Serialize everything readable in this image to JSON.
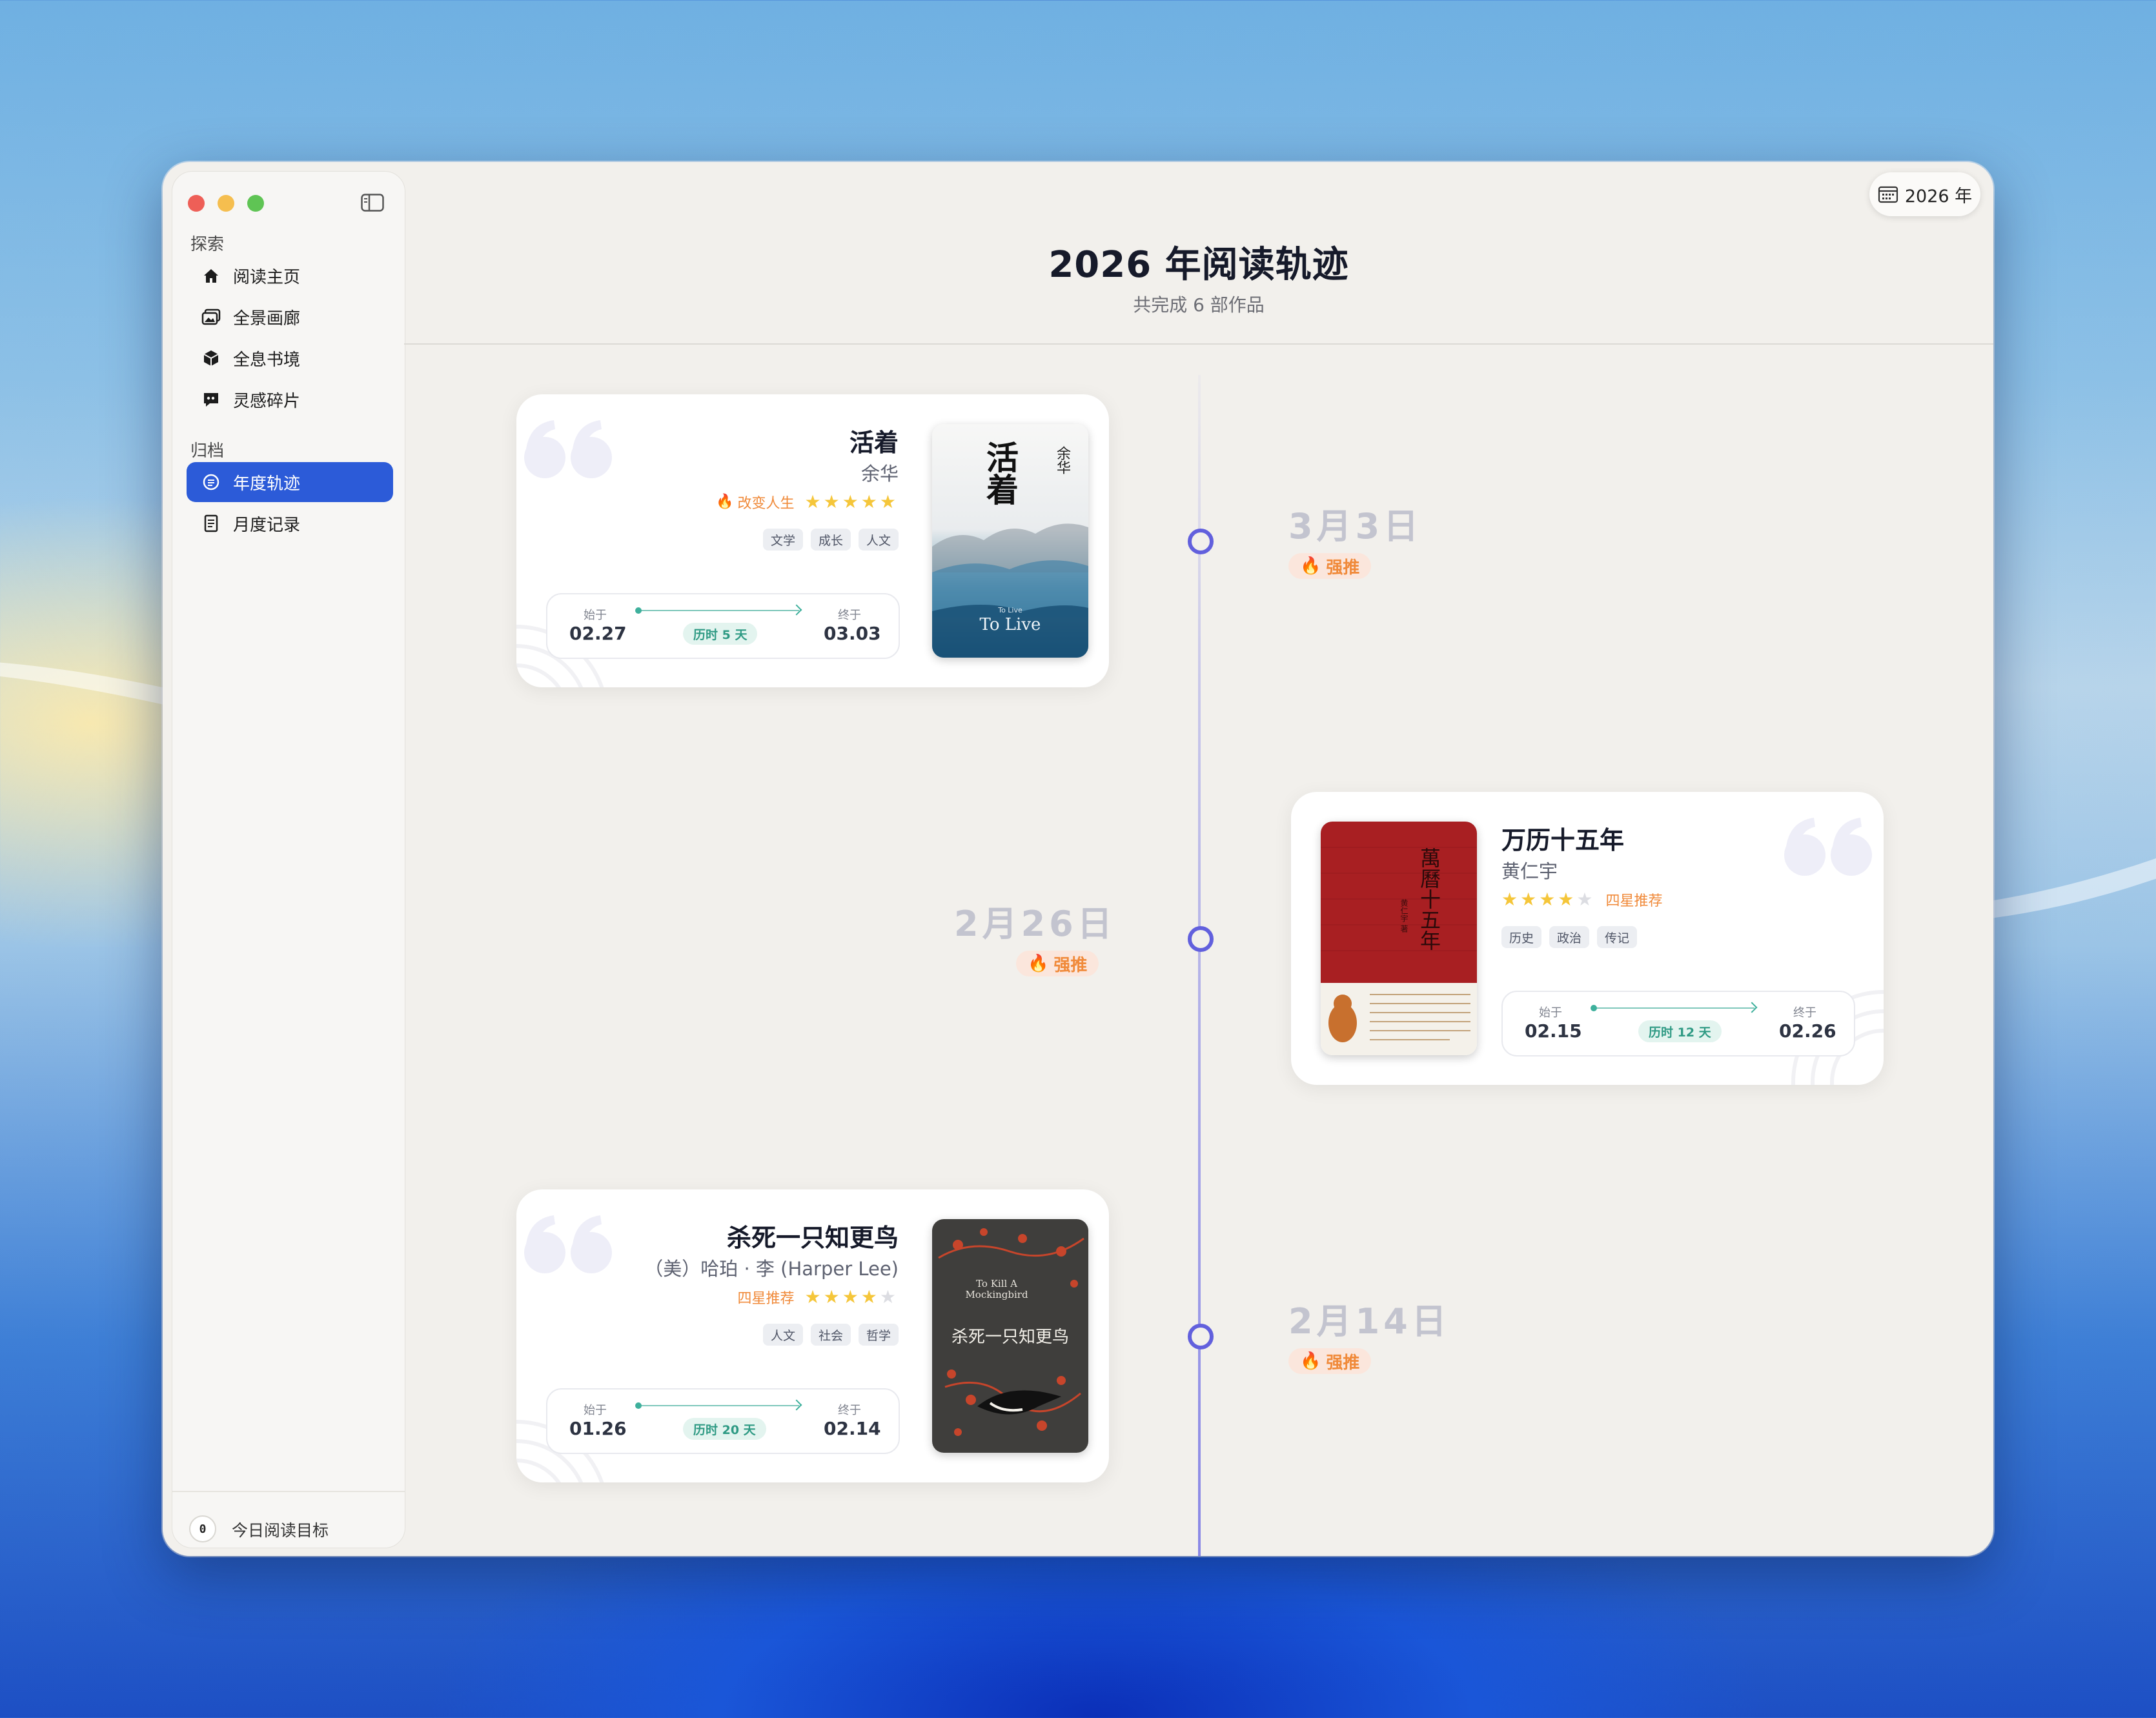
{
  "sidebar": {
    "section_explore": "探索",
    "explore_items": [
      {
        "label": "阅读主页",
        "icon": "house-icon"
      },
      {
        "label": "全景画廊",
        "icon": "photo-gallery-icon"
      },
      {
        "label": "全息书境",
        "icon": "cube-icon"
      },
      {
        "label": "灵感碎片",
        "icon": "quote-bubble-icon"
      }
    ],
    "section_archive": "归档",
    "archive_items": [
      {
        "label": "年度轨迹",
        "icon": "timeline-icon",
        "active": true
      },
      {
        "label": "月度记录",
        "icon": "document-icon",
        "active": false
      }
    ],
    "goal_count": "0",
    "goal_label": "今日阅读目标"
  },
  "toolbar": {
    "year_label": "2026 年",
    "year_icon": "calendar-icon"
  },
  "header": {
    "title": "2026 年阅读轨迹",
    "subtitle": "共完成 6 部作品"
  },
  "timeline": [
    {
      "date": "3月3日",
      "badge": "强推",
      "title": "活着",
      "author": "余华",
      "rating_label": "改变人生",
      "rating": 5,
      "tags": [
        "文学",
        "成长",
        "人文"
      ],
      "start_label": "始于",
      "start": "02.27",
      "end_label": "终于",
      "end": "03.03",
      "duration": "历时 5 天",
      "cover": {
        "title": "活着",
        "author": "余华",
        "subtitle_small": "To Live",
        "subtitle_en": "To Live"
      }
    },
    {
      "date": "2月26日",
      "badge": "强推",
      "title": "万历十五年",
      "author": "黄仁宇",
      "rating_label": "四星推荐",
      "rating": 4,
      "tags": [
        "历史",
        "政治",
        "传记"
      ],
      "start_label": "始于",
      "start": "02.15",
      "end_label": "终于",
      "end": "02.26",
      "duration": "历时 12 天",
      "cover": {
        "title": "萬曆十五年",
        "author": "黄仁宇 著"
      }
    },
    {
      "date": "2月14日",
      "badge": "强推",
      "title": "杀死一只知更鸟",
      "author": "（美）哈珀 · 李 (Harper Lee)",
      "rating_label": "四星推荐",
      "rating": 4,
      "tags": [
        "人文",
        "社会",
        "哲学"
      ],
      "start_label": "始于",
      "start": "01.26",
      "end_label": "终于",
      "end": "02.14",
      "duration": "历时 20 天",
      "cover": {
        "title_en": "To Kill A Mockingbird",
        "title_cn": "杀死一只知更鸟"
      }
    }
  ],
  "colors": {
    "accent": "#2c5bd8",
    "timeline": "#6260dd",
    "badge_text": "#f08a3a",
    "star": "#f5c63a",
    "duration": "#2f9a84"
  }
}
